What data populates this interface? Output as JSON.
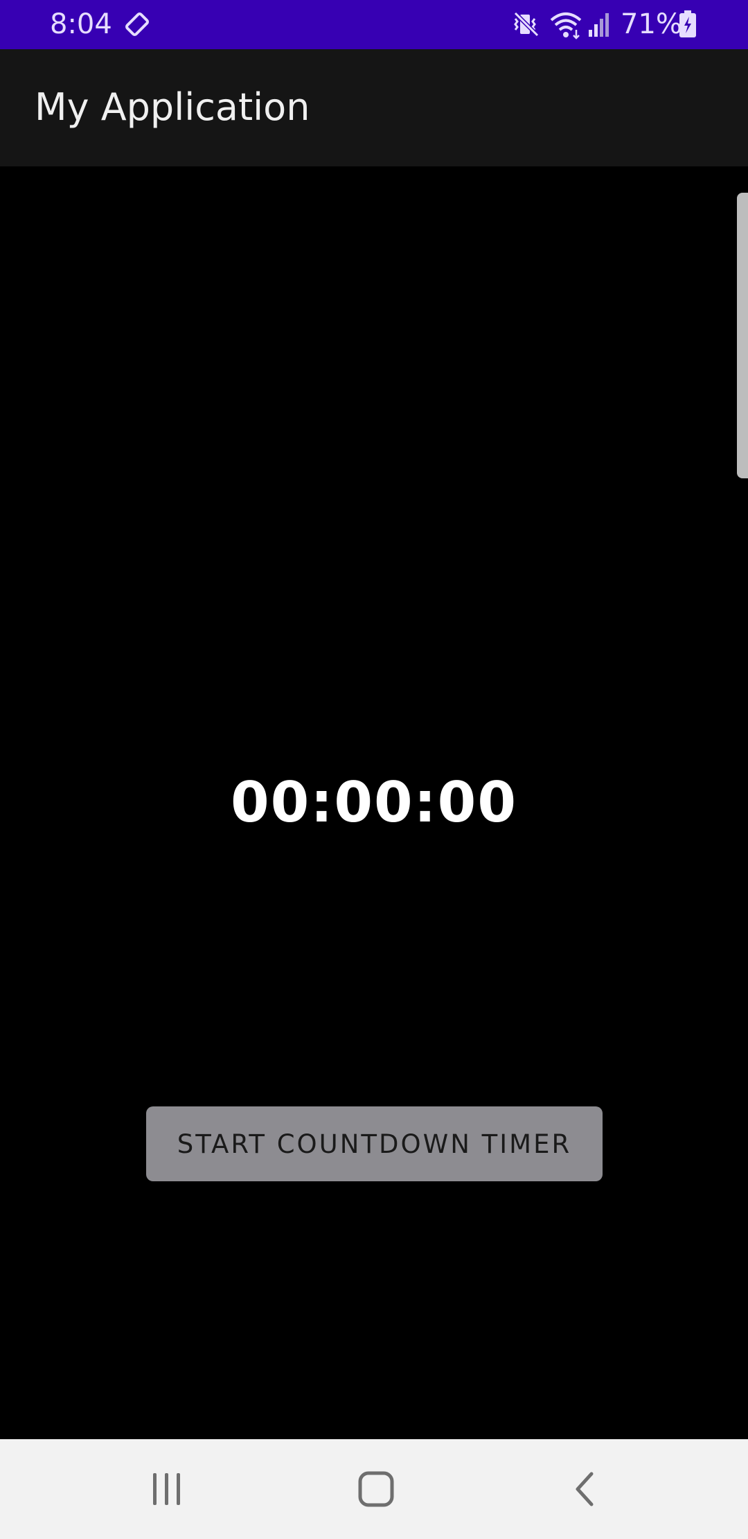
{
  "status_bar": {
    "time": "8:04",
    "battery_percent": "71%",
    "background_color": "#3700b3",
    "icons": [
      "screen-rotation-icon",
      "vibrate-mute-icon",
      "wifi-icon",
      "cell-signal-icon",
      "battery-charging-icon"
    ]
  },
  "app_bar": {
    "title": "My Application"
  },
  "timer": {
    "display": "00:00:00"
  },
  "actions": {
    "start_label": "START COUNTDOWN TIMER"
  },
  "navigation": {
    "buttons": [
      "recents",
      "home",
      "back"
    ]
  }
}
